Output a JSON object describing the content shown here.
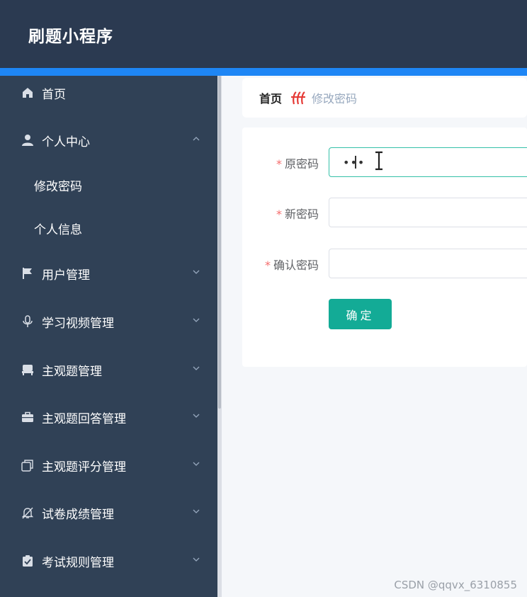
{
  "app": {
    "title": "刷题小程序"
  },
  "sidebar": {
    "home": {
      "label": "首页",
      "icon": "home-icon"
    },
    "items": [
      {
        "label": "个人中心",
        "icon": "user-icon",
        "expanded": true,
        "children": [
          {
            "label": "修改密码"
          },
          {
            "label": "个人信息"
          }
        ]
      },
      {
        "label": "用户管理",
        "icon": "flag-icon"
      },
      {
        "label": "学习视频管理",
        "icon": "microphone-icon"
      },
      {
        "label": "主观题管理",
        "icon": "chair-icon"
      },
      {
        "label": "主观题回答管理",
        "icon": "briefcase-icon"
      },
      {
        "label": "主观题评分管理",
        "icon": "copy-icon"
      },
      {
        "label": "试卷成绩管理",
        "icon": "bell-off-icon"
      },
      {
        "label": "考试规则管理",
        "icon": "clipboard-check-icon"
      }
    ]
  },
  "breadcrumb": {
    "home": "首页",
    "current": "修改密码"
  },
  "form": {
    "old_password_label": "原密码",
    "new_password_label": "新密码",
    "confirm_password_label": "确认密码",
    "required_mark": "*",
    "old_password_value": "•••",
    "submit_label": "确定"
  },
  "watermark": "CSDN @qqvx_6310855",
  "colors": {
    "header": "#2b3a51",
    "sidebar": "#304156",
    "accent": "#1e86f5",
    "primary_button": "#13ab96",
    "required": "#f56c6c"
  }
}
